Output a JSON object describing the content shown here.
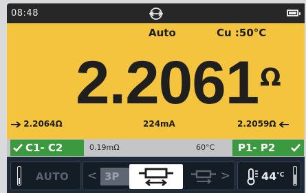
{
  "status": {
    "time": "08:48",
    "connection_icon": "link-icon",
    "battery_icon": "battery-full-icon"
  },
  "header": {
    "mode": "Auto",
    "material": "Cu :50°C"
  },
  "reading": {
    "value": "2.2061",
    "unit": "Ω"
  },
  "sub_readings": {
    "forward": "2.2064Ω",
    "current": "224mA",
    "reverse": "2.2059Ω"
  },
  "leads": {
    "left_label": "C1- C2",
    "left_status": "ok",
    "resistance": "0.19mΩ",
    "temperature": "60°C",
    "right_label": "P1- P2",
    "right_status": "ok"
  },
  "bottom": {
    "auto_label": "AUTO",
    "mode_option_3p": "3P",
    "selected_mode_icon": "bidirectional-icon",
    "next_mode_icon": "single-direction-icon",
    "temp_value": "44",
    "temp_unit": "°C"
  },
  "colors": {
    "background": "#f5c43e",
    "ok_green": "#3b9a3f",
    "status_bar": "#272727",
    "bottom_bar": "#1f2a38"
  }
}
